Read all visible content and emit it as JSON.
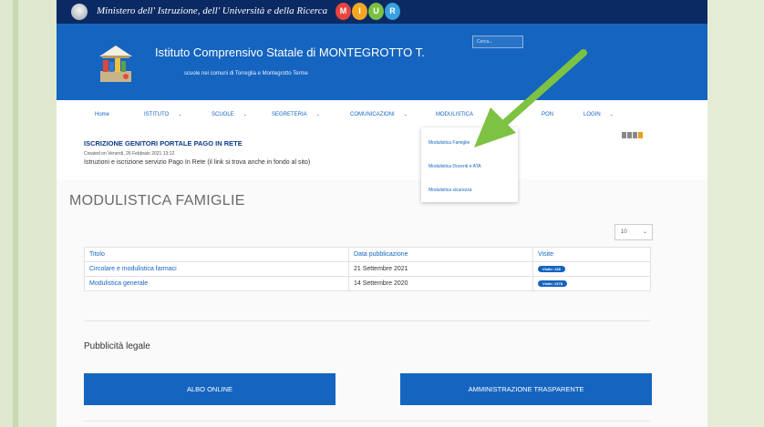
{
  "ministry": {
    "text": "Ministero dell' Istruzione, dell' Università e della Ricerca",
    "logo_letters": [
      "M",
      "I",
      "U",
      "R"
    ]
  },
  "header": {
    "school_name": "Istituto Comprensivo Statale di MONTEGROTTO T.",
    "subtitle": "scuole nei comuni di Torreglia e Montegrotto Terme",
    "search_placeholder": "Cerca..."
  },
  "nav": {
    "items": [
      {
        "label": "Home",
        "caret": false
      },
      {
        "label": "ISTITUTO",
        "caret": true
      },
      {
        "label": "SCUOLE",
        "caret": true
      },
      {
        "label": "SEGRETERIA",
        "caret": true
      },
      {
        "label": "COMUNICAZIONI",
        "caret": true
      },
      {
        "label": "MODULISTICA",
        "caret": false
      },
      {
        "label": "PON",
        "caret": false
      },
      {
        "label": "LOGIN",
        "caret": true
      }
    ],
    "caret_glyph": "⌄",
    "dropdown": [
      "Modulistica Famiglie",
      "Modulistica Docenti e ATA",
      "Modulistica sicurezza"
    ]
  },
  "news": {
    "title": "ISCRIZIONE GENITORI PORTALE PAGO IN RETE",
    "meta": "Created on Venerdì, 26 Febbraio 2021 13:12",
    "desc": "Istruzioni e iscrizione servizio Pago In Rete (il link si trova anche in fondo al sito)"
  },
  "main": {
    "heading": "MODULISTICA FAMIGLIE",
    "per_page": "10",
    "table": {
      "headers": [
        "Titolo",
        "Data pubblicazione",
        "Visite"
      ],
      "rows": [
        {
          "title": "Circolare e modulistica farmaci",
          "date": "21 Settembre 2021",
          "visits": "Visite: 128"
        },
        {
          "title": "Modulistica generale",
          "date": "14 Settembre 2020",
          "visits": "Visite: 1378"
        }
      ]
    },
    "pub_heading": "Pubblicità legale",
    "buttons": [
      "ALBO ONLINE",
      "AMMINISTRAZIONE TRASPARENTE"
    ]
  },
  "colors": {
    "header_blue": "#1565c0",
    "ministry_navy": "#0b2a63",
    "arrow_green": "#7dc242",
    "miur": [
      "#e8453c",
      "#f5a623",
      "#7bc043",
      "#3aa0e0"
    ]
  }
}
